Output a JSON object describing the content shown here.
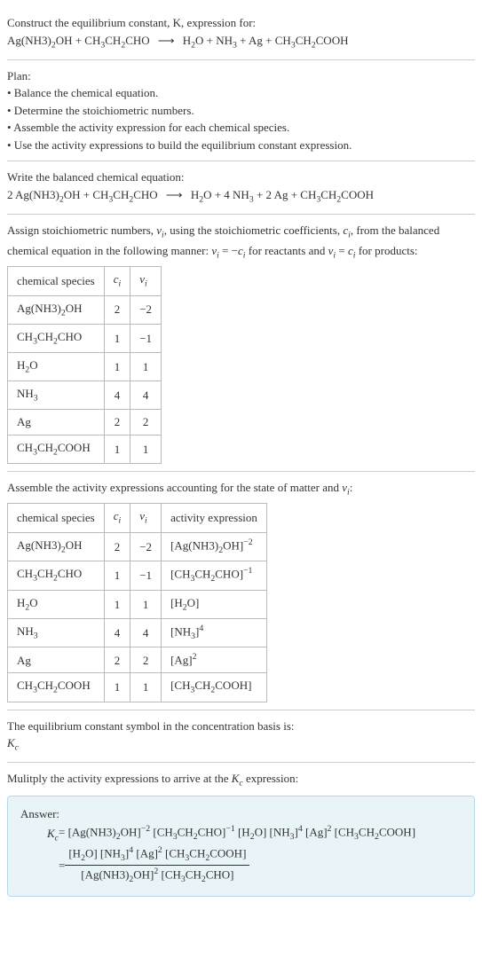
{
  "s1": {
    "intro": "Construct the equilibrium constant, K, expression for:",
    "eq_lhs1": "Ag(NH3)",
    "eq_lhs1_sub": "2",
    "eq_lhs1b": "OH + CH",
    "eq_lhs1b_sub": "3",
    "eq_lhs1c": "CH",
    "eq_lhs1c_sub": "2",
    "eq_lhs1d": "CHO",
    "arrow": "⟶",
    "eq_rhs1": "H",
    "eq_rhs1_sub": "2",
    "eq_rhs1b": "O + NH",
    "eq_rhs1b_sub": "3",
    "eq_rhs1c": " + Ag + CH",
    "eq_rhs1c_sub": "3",
    "eq_rhs1d": "CH",
    "eq_rhs1d_sub": "2",
    "eq_rhs1e": "COOH"
  },
  "s2": {
    "title": "Plan:",
    "b1": "• Balance the chemical equation.",
    "b2": "• Determine the stoichiometric numbers.",
    "b3": "• Assemble the activity expression for each chemical species.",
    "b4": "• Use the activity expressions to build the equilibrium constant expression."
  },
  "s3": {
    "title": "Write the balanced chemical equation:",
    "pre1": "2 Ag(NH3)",
    "sub1": "2",
    "t2": "OH + CH",
    "sub2": "3",
    "t3": "CH",
    "sub3": "2",
    "t4": "CHO",
    "arrow": "⟶",
    "t5": "H",
    "sub5": "2",
    "t6": "O + 4 NH",
    "sub6": "3",
    "t7": " + 2 Ag + CH",
    "sub7": "3",
    "t8": "CH",
    "sub8": "2",
    "t9": "COOH"
  },
  "s4": {
    "text_a": "Assign stoichiometric numbers, ",
    "nu": "ν",
    "i": "i",
    "text_b": ", using the stoichiometric coefficients, ",
    "c": "c",
    "text_c": ", from the balanced chemical equation in the following manner: ",
    "rel1a": "ν",
    "rel1b": " = −",
    "rel1c": "c",
    "text_d": " for reactants and ",
    "rel2a": "ν",
    "rel2b": " = ",
    "rel2c": "c",
    "text_e": " for products:",
    "th1": "chemical species",
    "th2": "c",
    "th3": "ν",
    "rows": [
      {
        "sp_a": "Ag(NH3)",
        "sp_sub": "2",
        "sp_b": "OH",
        "c": "2",
        "nu": "−2"
      },
      {
        "sp_a": "CH",
        "sp_sub": "3",
        "sp_b": "CH",
        "sp_sub2": "2",
        "sp_c": "CHO",
        "c": "1",
        "nu": "−1"
      },
      {
        "sp_a": "H",
        "sp_sub": "2",
        "sp_b": "O",
        "c": "1",
        "nu": "1"
      },
      {
        "sp_a": "NH",
        "sp_sub": "3",
        "sp_b": "",
        "c": "4",
        "nu": "4"
      },
      {
        "sp_a": "Ag",
        "sp_sub": "",
        "sp_b": "",
        "c": "2",
        "nu": "2"
      },
      {
        "sp_a": "CH",
        "sp_sub": "3",
        "sp_b": "CH",
        "sp_sub2": "2",
        "sp_c": "COOH",
        "c": "1",
        "nu": "1"
      }
    ]
  },
  "s5": {
    "title": "Assemble the activity expressions accounting for the state of matter and ",
    "nu": "ν",
    "i": "i",
    "colon": ":",
    "th1": "chemical species",
    "th2": "c",
    "th3": "ν",
    "th4": "activity expression"
  },
  "s6": {
    "text": "The equilibrium constant symbol in the concentration basis is:",
    "K": "K",
    "c": "c"
  },
  "s7": {
    "text": "Mulitply the activity expressions to arrive at the ",
    "K": "K",
    "c": "c",
    "text2": " expression:"
  },
  "ans": {
    "title": "Answer:",
    "K": "K",
    "c": "c",
    "eq": " = ",
    "line1": "[Ag(NH3)₂OH]⁻² [CH₃CH₂CHO]⁻¹ [H₂O] [NH₃]⁴ [Ag]² [CH₃CH₂COOH]",
    "eq2": "= ",
    "num": "[H₂O] [NH₃]⁴ [Ag]² [CH₃CH₂COOH]",
    "den": "[Ag(NH3)₂OH]² [CH₃CH₂CHO]"
  }
}
